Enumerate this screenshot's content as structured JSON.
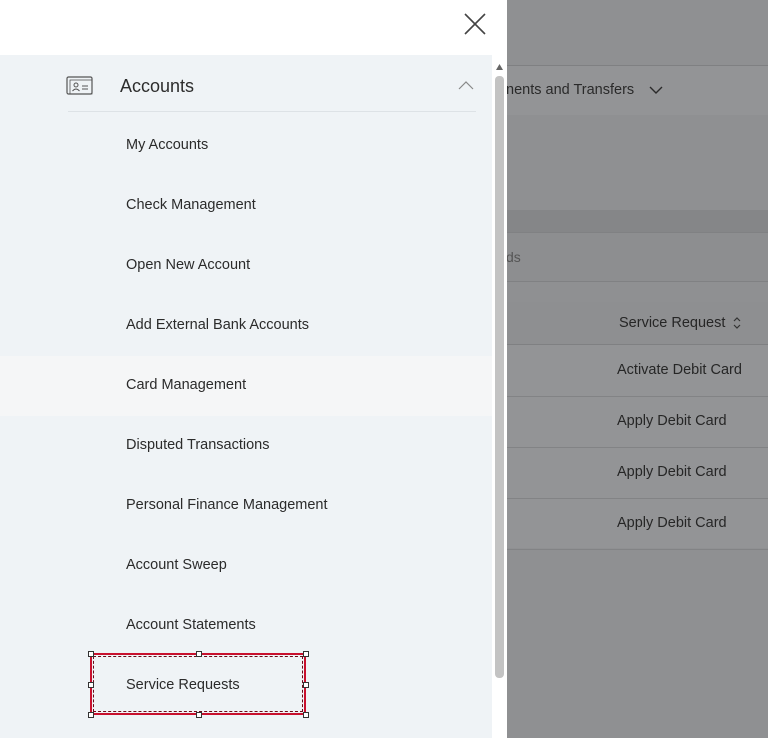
{
  "background": {
    "nav_label": "nents and Transfers",
    "search_fragment": "ds",
    "table_header": "Service Request",
    "rows": [
      "Activate Debit Card",
      "Apply Debit Card",
      "Apply Debit Card",
      "Apply Debit Card"
    ]
  },
  "drawer": {
    "section_label": "Accounts",
    "items": [
      "My Accounts",
      "Check Management",
      "Open New Account",
      "Add External Bank Accounts",
      "Card Management",
      "Disputed Transactions",
      "Personal Finance Management",
      "Account Sweep",
      "Account Statements",
      "Service Requests"
    ]
  },
  "colors": {
    "menu_bg": "#eff3f6",
    "highlight_border": "#c8102e",
    "overlay": "#8f9092"
  },
  "icons": {
    "close": "close-icon",
    "accounts": "id-card-icon",
    "collapse": "chevron-up-icon",
    "nav_expand": "chevron-down-icon",
    "sort": "sort-icon"
  }
}
